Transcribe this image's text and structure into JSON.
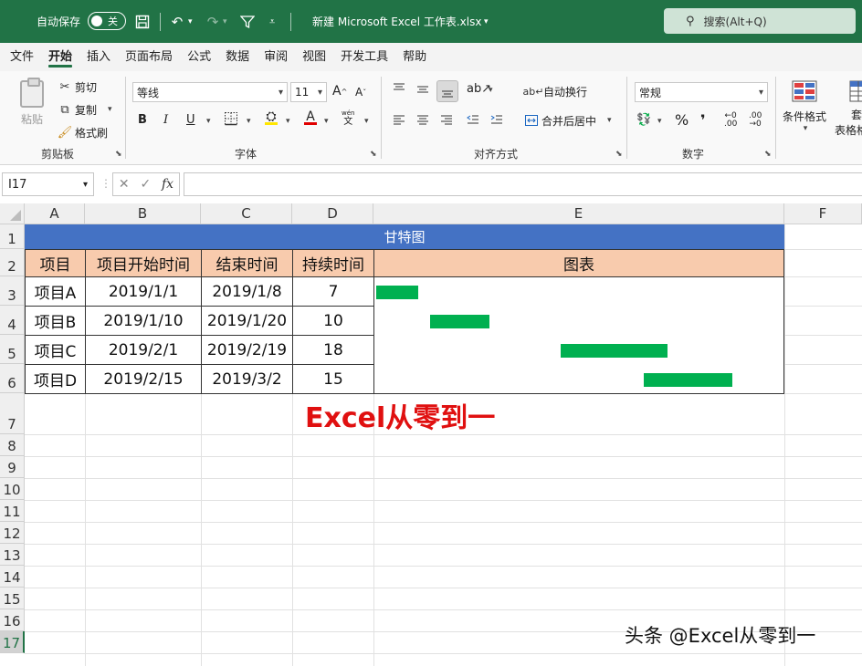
{
  "titlebar": {
    "autosave_label": "自动保存",
    "autosave_state": "关",
    "filename": "新建 Microsoft Excel 工作表.xlsx",
    "search_placeholder": "搜索(Alt+Q)"
  },
  "tabs": [
    "文件",
    "开始",
    "插入",
    "页面布局",
    "公式",
    "数据",
    "审阅",
    "视图",
    "开发工具",
    "帮助"
  ],
  "active_tab": "开始",
  "ribbon": {
    "clipboard": {
      "label": "剪贴板",
      "paste": "粘贴",
      "cut": "剪切",
      "copy": "复制",
      "format_painter": "格式刷"
    },
    "font": {
      "label": "字体",
      "font_name": "等线",
      "font_size": "11",
      "bold": "B",
      "italic": "I",
      "underline": "U",
      "phonetic_top": "wén",
      "phonetic_bottom": "文"
    },
    "alignment": {
      "label": "对齐方式",
      "wrap_text": "自动换行",
      "merge_center": "合并后居中"
    },
    "number": {
      "label": "数字",
      "format": "常规"
    },
    "styles": {
      "conditional_format": "条件格式",
      "table_format_partial": "套",
      "table_format_partial_2": "表格格"
    }
  },
  "formula_bar": {
    "name_box": "I17",
    "formula": ""
  },
  "columns": [
    "A",
    "B",
    "C",
    "D",
    "E",
    "F"
  ],
  "rows": [
    "1",
    "2",
    "3",
    "4",
    "5",
    "6",
    "7",
    "8",
    "9",
    "10",
    "11",
    "12",
    "13",
    "14",
    "15",
    "16",
    "17"
  ],
  "sheet": {
    "title": "甘特图",
    "headers": [
      "项目",
      "项目开始时间",
      "结束时间",
      "持续时间",
      "图表"
    ],
    "tasks": [
      {
        "name": "项目A",
        "start": "2019/1/1",
        "end": "2019/1/8",
        "duration": "7"
      },
      {
        "name": "项目B",
        "start": "2019/1/10",
        "end": "2019/1/20",
        "duration": "10"
      },
      {
        "name": "项目C",
        "start": "2019/2/1",
        "end": "2019/2/19",
        "duration": "18"
      },
      {
        "name": "项目D",
        "start": "2019/2/15",
        "end": "2019/3/2",
        "duration": "15"
      }
    ],
    "gantt_bar_color": "#00b050",
    "title_color": "#4472c4",
    "header_color": "#f8cbad"
  },
  "watermark_red": "Excel从零到一",
  "watermark_bottom": "头条 @Excel从零到一",
  "colors": {
    "accent": "#217346"
  }
}
